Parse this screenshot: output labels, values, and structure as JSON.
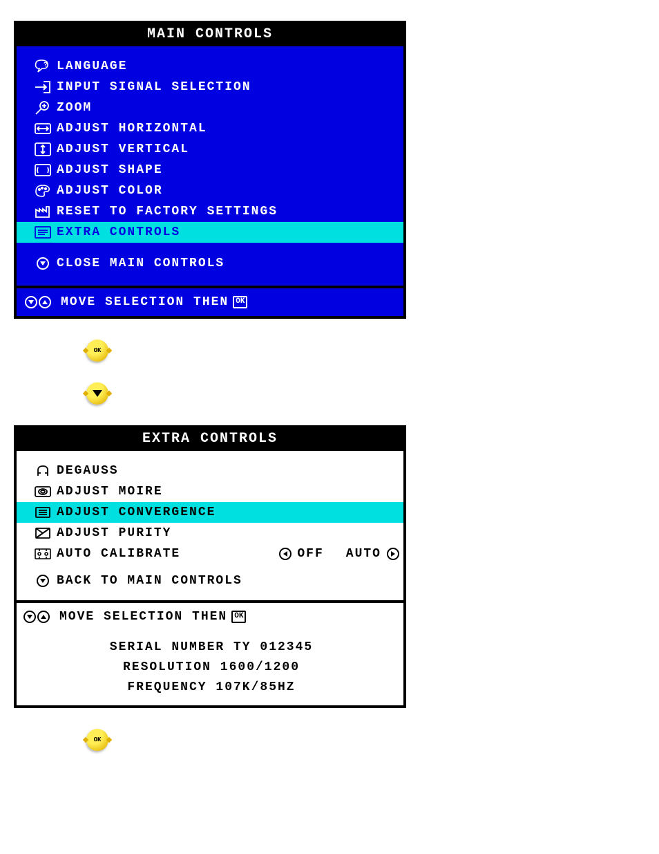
{
  "main": {
    "title": "MAIN CONTROLS",
    "items": [
      {
        "label": "LANGUAGE"
      },
      {
        "label": "INPUT SIGNAL SELECTION"
      },
      {
        "label": "ZOOM"
      },
      {
        "label": "ADJUST HORIZONTAL"
      },
      {
        "label": "ADJUST VERTICAL"
      },
      {
        "label": "ADJUST SHAPE"
      },
      {
        "label": "ADJUST COLOR"
      },
      {
        "label": "RESET TO FACTORY SETTINGS"
      },
      {
        "label": "EXTRA CONTROLS"
      }
    ],
    "close": "CLOSE MAIN CONTROLS",
    "footer": "MOVE SELECTION THEN"
  },
  "extra": {
    "title": "EXTRA CONTROLS",
    "items": [
      {
        "label": "DEGAUSS"
      },
      {
        "label": "ADJUST MOIRE"
      },
      {
        "label": "ADJUST CONVERGENCE"
      },
      {
        "label": "ADJUST PURITY"
      },
      {
        "label": "AUTO CALIBRATE",
        "off": "OFF",
        "auto": "AUTO"
      }
    ],
    "back": "BACK TO MAIN CONTROLS",
    "footer": "MOVE SELECTION THEN",
    "serial": "SERIAL NUMBER TY 012345",
    "resolution": "RESOLUTION 1600/1200",
    "frequency": "FREQUENCY 107K/85HZ"
  },
  "ok": "OK"
}
